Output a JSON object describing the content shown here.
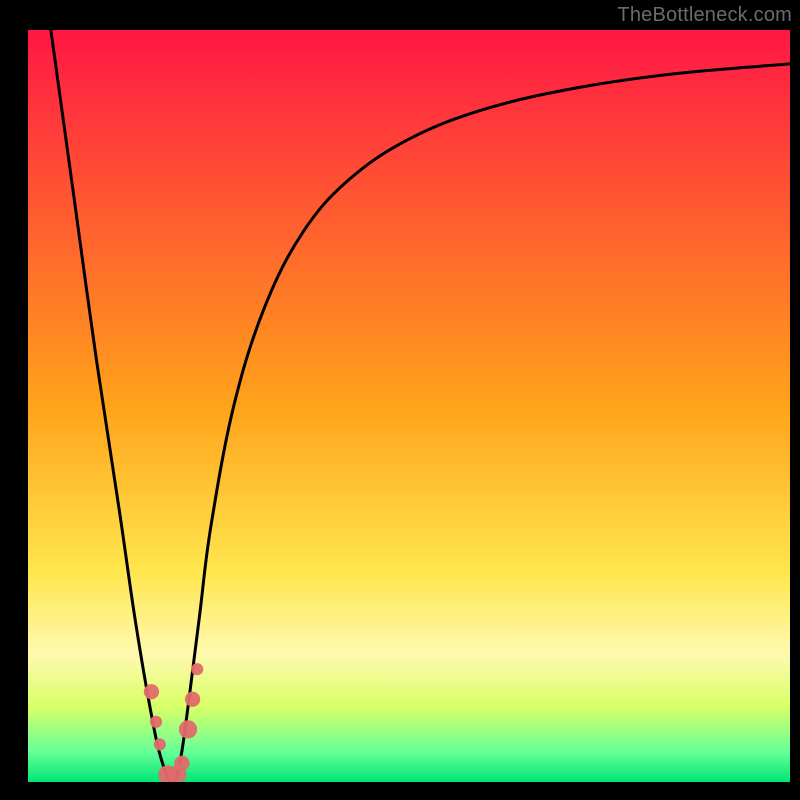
{
  "watermark": "TheBottleneck.com",
  "chart_data": {
    "type": "line",
    "title": "",
    "xlabel": "",
    "ylabel": "",
    "xlim": [
      0,
      100
    ],
    "ylim": [
      0,
      100
    ],
    "grid": false,
    "legend": false,
    "background_gradient": {
      "stops": [
        {
          "pos": 0.0,
          "color": "#ff1745"
        },
        {
          "pos": 0.5,
          "color": "#ffa31a"
        },
        {
          "pos": 0.72,
          "color": "#ffe64d"
        },
        {
          "pos": 0.83,
          "color": "#fff9b0"
        },
        {
          "pos": 0.9,
          "color": "#d8ff66"
        },
        {
          "pos": 0.96,
          "color": "#66ff99"
        },
        {
          "pos": 1.0,
          "color": "#00e673"
        }
      ]
    },
    "series": [
      {
        "name": "bottleneck-curve",
        "x": [
          3,
          6,
          9,
          12,
          14,
          16,
          17.5,
          19,
          20,
          21,
          22.5,
          24,
          27,
          31,
          36,
          42,
          50,
          60,
          72,
          85,
          100
        ],
        "y": [
          100,
          78,
          56,
          36,
          22,
          10,
          3,
          0,
          3,
          10,
          22,
          34,
          50,
          63,
          73,
          80,
          85.5,
          89.5,
          92.3,
          94.2,
          95.5
        ]
      }
    ],
    "markers": {
      "name": "highlight-points",
      "color": "#e26a6a",
      "points": [
        {
          "x": 16.2,
          "y": 12.0,
          "r": 1.0
        },
        {
          "x": 16.8,
          "y": 8.0,
          "r": 0.8
        },
        {
          "x": 17.3,
          "y": 5.0,
          "r": 0.8
        },
        {
          "x": 18.3,
          "y": 1.0,
          "r": 1.2
        },
        {
          "x": 19.6,
          "y": 1.0,
          "r": 1.2
        },
        {
          "x": 20.2,
          "y": 2.5,
          "r": 1.0
        },
        {
          "x": 21.0,
          "y": 7.0,
          "r": 1.2
        },
        {
          "x": 21.6,
          "y": 11.0,
          "r": 1.0
        },
        {
          "x": 22.2,
          "y": 15.0,
          "r": 0.8
        }
      ]
    }
  }
}
